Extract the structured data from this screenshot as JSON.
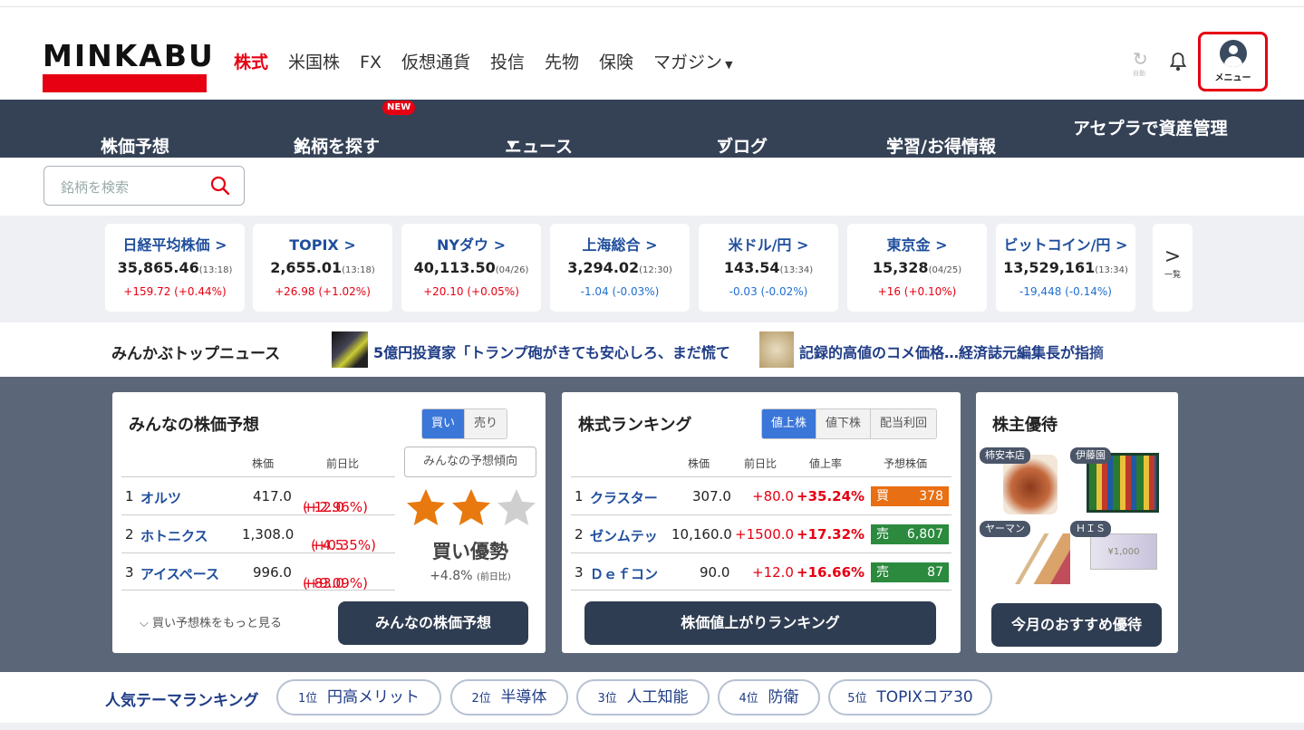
{
  "logo": {
    "text": "MINKABU"
  },
  "global_nav": [
    {
      "label": "株式",
      "active": true
    },
    {
      "label": "米国株"
    },
    {
      "label": "FX"
    },
    {
      "label": "仮想通貨"
    },
    {
      "label": "投信"
    },
    {
      "label": "先物"
    },
    {
      "label": "保険"
    },
    {
      "label": "マガジン",
      "dropdown": true
    }
  ],
  "header_icons": {
    "sync_label": "自動",
    "menu_label": "メニュー"
  },
  "sub_nav": [
    {
      "label": "株価予想",
      "dropdown": true
    },
    {
      "label": "銘柄を探す",
      "dropdown": true,
      "badge": "NEW"
    },
    {
      "label": "ニュース",
      "dropdown": true
    },
    {
      "label": "ブログ",
      "dropdown": true
    },
    {
      "label": "学習/お得情報",
      "dropdown": true
    },
    {
      "label": "アセプラで資産管理"
    }
  ],
  "search": {
    "placeholder": "銘柄を検索"
  },
  "tickers": [
    {
      "name": "日経平均株価 >",
      "value": "35,865.46",
      "time": "(13:18)",
      "change": "+159.72 (+0.44%)",
      "dir": "up"
    },
    {
      "name": "TOPIX >",
      "value": "2,655.01",
      "time": "(13:18)",
      "change": "+26.98 (+1.02%)",
      "dir": "up"
    },
    {
      "name": "NYダウ >",
      "value": "40,113.50",
      "time": "(04/26)",
      "change": "+20.10 (+0.05%)",
      "dir": "up"
    },
    {
      "name": "上海総合 >",
      "value": "3,294.02",
      "time": "(12:30)",
      "change": "-1.04 (-0.03%)",
      "dir": "down"
    },
    {
      "name": "米ドル/円 >",
      "value": "143.54",
      "time": "(13:34)",
      "change": "-0.03 (-0.02%)",
      "dir": "down"
    },
    {
      "name": "東京金 >",
      "value": "15,328",
      "time": "(04/25)",
      "change": "+16 (+0.10%)",
      "dir": "up"
    },
    {
      "name": "ビットコイン/円 >",
      "value": "13,529,161",
      "time": "(13:34)",
      "change": "-19,448 (-0.14%)",
      "dir": "down"
    }
  ],
  "tickers_more": {
    "arrow": ">",
    "label": "一覧"
  },
  "top_news": {
    "title": "みんかぶトップニュース",
    "items": [
      "5億円投資家「トランプ砲がきても安心しろ、まだ慌て",
      "記録的高値のコメ価格…経済誌元編集長が指摘"
    ]
  },
  "prediction": {
    "title": "みんなの株価予想",
    "tabs": [
      "買い",
      "売り"
    ],
    "headers": [
      "株価",
      "前日比"
    ],
    "rows": [
      {
        "rank": "1",
        "name": "オルツ",
        "price": "417.0",
        "change": "+12.0",
        "pct": "(+2.96%)"
      },
      {
        "rank": "2",
        "name": "ホトニクス",
        "price": "1,308.0",
        "change": "+4.5",
        "pct": "(+0.35%)"
      },
      {
        "rank": "3",
        "name": "アイスペース",
        "price": "996.0",
        "change": "+83.0",
        "pct": "(+9.09%)"
      }
    ],
    "trend_button": "みんなの予想傾向",
    "stars_filled": 2,
    "stars_total": 3,
    "trend": "買い優勢",
    "trend_change": "+4.8%",
    "trend_change_note": "(前日比)",
    "more_link": "買い予想株をもっと見る",
    "cta": "みんなの株価予想"
  },
  "ranking": {
    "title": "株式ランキング",
    "tabs": [
      "値上株",
      "値下株",
      "配当利回"
    ],
    "headers": [
      "株価",
      "前日比",
      "値上率",
      "予想株価"
    ],
    "rows": [
      {
        "rank": "1",
        "name": "クラスター",
        "price": "307.0",
        "change": "+80.0",
        "rate": "+35.24%",
        "pred_type": "買",
        "pred": "378"
      },
      {
        "rank": "2",
        "name": "ゼンムテッ",
        "price": "10,160.0",
        "change": "+1500.0",
        "rate": "+17.32%",
        "pred_type": "売",
        "pred": "6,807"
      },
      {
        "rank": "3",
        "name": "Ｄｅｆコン",
        "price": "90.0",
        "change": "+12.0",
        "rate": "+16.66%",
        "pred_type": "売",
        "pred": "87"
      }
    ],
    "cta": "株価値上がりランキング"
  },
  "yutai": {
    "title": "株主優待",
    "items": [
      "柿安本店",
      "伊藤園",
      "ヤーマン",
      "ＨＩＳ"
    ],
    "cta": "今月のおすすめ優待"
  },
  "themes": {
    "title": "人気テーマランキング",
    "items": [
      {
        "rank": "1位",
        "name": "円高メリット"
      },
      {
        "rank": "2位",
        "name": "半導体"
      },
      {
        "rank": "3位",
        "name": "人工知能"
      },
      {
        "rank": "4位",
        "name": "防衛"
      },
      {
        "rank": "5位",
        "name": "TOPIXコア30"
      }
    ]
  },
  "colors": {
    "brand_red": "#e60012",
    "nav_dark": "#354256",
    "link_blue": "#1f4e9c",
    "panel_bg": "#5b6778"
  }
}
